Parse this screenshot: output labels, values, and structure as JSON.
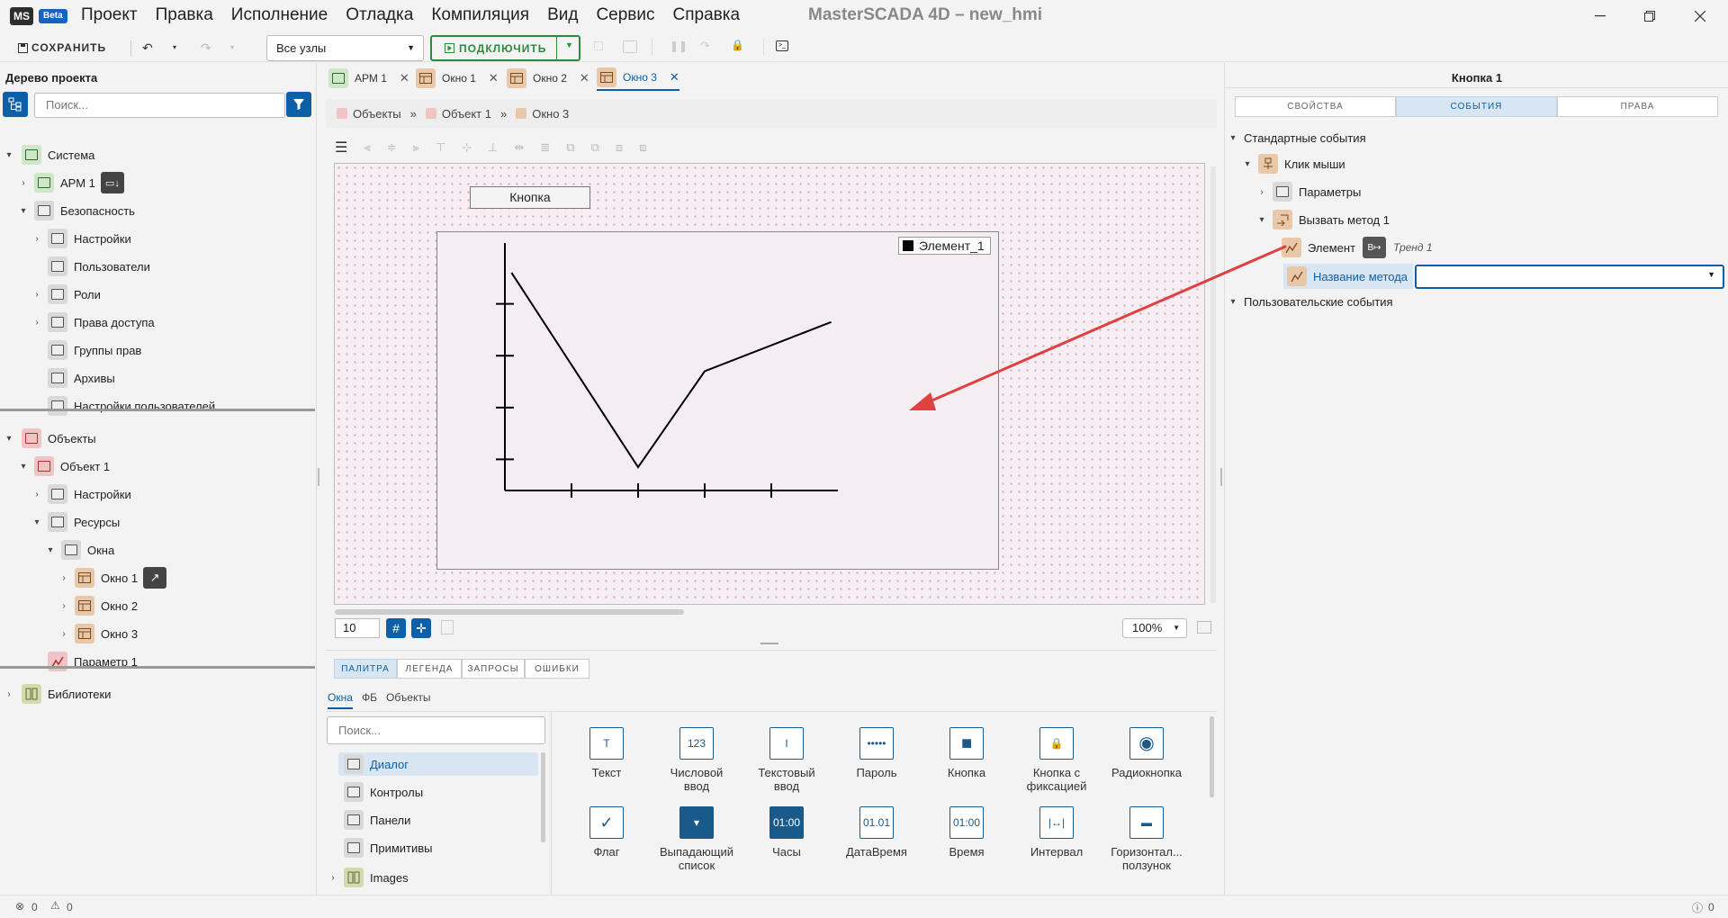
{
  "app": {
    "logo": "MS",
    "beta": "Beta",
    "window_title": "MasterSCADA 4D – new_hmi"
  },
  "menu": [
    "Проект",
    "Правка",
    "Исполнение",
    "Отладка",
    "Компиляция",
    "Вид",
    "Сервис",
    "Справка"
  ],
  "toolbar": {
    "save": "СОХРАНИТЬ",
    "nodes_select": "Все узлы",
    "connect": "ПОДКЛЮЧИТЬ"
  },
  "project_tree": {
    "title": "Дерево проекта",
    "search_placeholder": "Поиск...",
    "items": [
      {
        "label": "Система"
      },
      {
        "label": "АРМ 1"
      },
      {
        "label": "Безопасность"
      },
      {
        "label": "Настройки"
      },
      {
        "label": "Пользователи"
      },
      {
        "label": "Роли"
      },
      {
        "label": "Права доступа"
      },
      {
        "label": "Группы прав"
      },
      {
        "label": "Архивы"
      },
      {
        "label": "Настройки пользователей"
      },
      {
        "label": "Объекты"
      },
      {
        "label": "Объект 1"
      },
      {
        "label": "Настройки"
      },
      {
        "label": "Ресурсы"
      },
      {
        "label": "Окна"
      },
      {
        "label": "Окно 1"
      },
      {
        "label": "Окно 2"
      },
      {
        "label": "Окно 3"
      },
      {
        "label": "Параметр 1"
      },
      {
        "label": "Библиотеки"
      }
    ]
  },
  "doc_tabs": [
    {
      "label": "АРМ 1"
    },
    {
      "label": "Окно 1"
    },
    {
      "label": "Окно 2"
    },
    {
      "label": "Окно 3",
      "active": true
    }
  ],
  "breadcrumb": [
    "Объекты",
    "Объект 1",
    "Окно 3"
  ],
  "canvas": {
    "button_label": "Кнопка",
    "trend_legend": "Элемент_1",
    "grid_size": "10",
    "zoom": "100%"
  },
  "chart_data": {
    "type": "line",
    "title": "",
    "xlabel": "",
    "ylabel": "",
    "legend": [
      "Элемент_1"
    ],
    "series": [
      {
        "name": "Элемент_1",
        "x": [
          0.1,
          2.0,
          3.0,
          4.9
        ],
        "y": [
          4.2,
          0.45,
          2.3,
          3.25
        ]
      }
    ],
    "xlim": [
      0,
      5
    ],
    "ylim": [
      0,
      4.6
    ],
    "x_ticks": [
      1,
      2,
      3,
      4
    ],
    "y_ticks": [
      0.6,
      1.6,
      2.6,
      3.6
    ],
    "grid": false
  },
  "bottom_panel": {
    "tabs": [
      "ПАЛИТРА",
      "ЛЕГЕНДА",
      "ЗАПРОСЫ",
      "ОШИБКИ"
    ],
    "subtabs": [
      "Окна",
      "ФБ",
      "Объекты"
    ],
    "search_placeholder": "Поиск...",
    "categories": [
      "Диалог",
      "Контролы",
      "Панели",
      "Примитивы",
      "Images"
    ],
    "items": [
      {
        "label": "Текст",
        "icon": "text-icon",
        "glyph": "T"
      },
      {
        "label": "Числовой ввод",
        "icon": "numeric-input-icon",
        "glyph": "123"
      },
      {
        "label": "Текстовый ввод",
        "icon": "text-input-icon",
        "glyph": "I"
      },
      {
        "label": "Пароль",
        "icon": "password-icon",
        "glyph": "•••••"
      },
      {
        "label": "Кнопка",
        "icon": "button-icon",
        "glyph": "■"
      },
      {
        "label": "Кнопка с фиксацией",
        "icon": "lock-button-icon",
        "glyph": "🔒"
      },
      {
        "label": "Радиокнопка",
        "icon": "radio-icon",
        "glyph": "◉"
      },
      {
        "label": "Флаг",
        "icon": "checkbox-icon",
        "glyph": "✓"
      },
      {
        "label": "Выпадающий список",
        "icon": "dropdown-icon",
        "glyph": "▾"
      },
      {
        "label": "Часы",
        "icon": "clock-icon",
        "glyph": "01:00"
      },
      {
        "label": "ДатаВремя",
        "icon": "datetime-icon",
        "glyph": "01.01"
      },
      {
        "label": "Время",
        "icon": "time-icon",
        "glyph": "01:00"
      },
      {
        "label": "Интервал",
        "icon": "interval-icon",
        "glyph": "|↔|"
      },
      {
        "label": "Горизонтал... ползунок",
        "icon": "slider-icon",
        "glyph": "▬"
      }
    ]
  },
  "properties": {
    "title": "Кнопка 1",
    "tabs": [
      "СВОЙСТВА",
      "СОБЫТИЯ",
      "ПРАВА"
    ],
    "tree": {
      "standard_events": "Стандартные события",
      "mouse_click": "Клик мыши",
      "parameters": "Параметры",
      "call_method": "Вызвать метод 1",
      "element": "Элемент",
      "element_value": "Тренд 1",
      "method_name": "Название метода",
      "user_events": "Пользовательские события"
    }
  },
  "status": {
    "errors": "0",
    "warnings": "0",
    "info": "0"
  },
  "colors": {
    "accent": "#1565c0",
    "connect": "#2e8b3d",
    "arrow": "#e04040"
  }
}
